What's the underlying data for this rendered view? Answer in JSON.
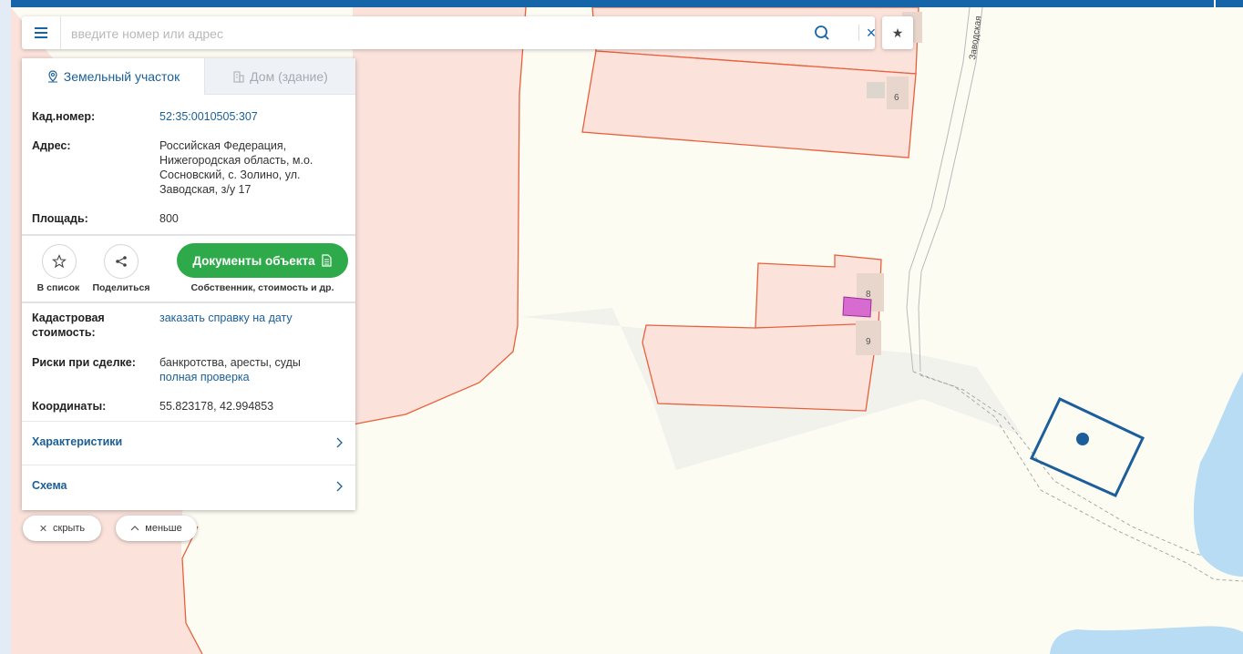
{
  "search": {
    "placeholder": "введите номер или адрес"
  },
  "tabs": [
    {
      "label": "Земельный участок",
      "icon": "location-pin-icon",
      "active": true
    },
    {
      "label": "Дом (здание)",
      "icon": "building-icon",
      "active": false
    }
  ],
  "info": {
    "cadnum_label": "Кад.номер:",
    "cadnum_value": "52:35:0010505:307",
    "address_label": "Адрес:",
    "address_lines": [
      "Российская Федерация,",
      "Нижегородская область, м.о.",
      "Сосновский, с. Золино, ул.",
      "Заводская, з/у 17"
    ],
    "area_label": "Площадь:",
    "area_value": "800"
  },
  "actions": {
    "to_list_label": "В список",
    "share_label": "Поделиться",
    "docs_button": "Документы объекта",
    "docs_sub": "Собственник, стоимость и др."
  },
  "details": {
    "cost_label_1": "Кадастровая",
    "cost_label_2": "стоимость:",
    "cost_link": "заказать справку на дату",
    "risks_label": "Риски при сделке:",
    "risks_text": "банкротства, аресты, суды",
    "risks_link": "полная проверка",
    "coords_label": "Координаты:",
    "coords_value": "55.823178, 42.994853"
  },
  "sections": {
    "characteristics": "Характеристики",
    "scheme": "Схема"
  },
  "bottom_buttons": {
    "hide": "скрыть",
    "less": "меньше"
  },
  "map_labels": {
    "street": "Заводская",
    "house_6": "6",
    "house_8": "8",
    "house_9": "9"
  },
  "colors": {
    "topbar": "#1565a8",
    "parcel_fill": "#fbe3dc",
    "parcel_stroke": "#e8603c",
    "selected_stroke": "#1c5e9c",
    "water": "#b8dcf3",
    "button_green": "#2eaa4a",
    "link": "#1a5f96"
  }
}
